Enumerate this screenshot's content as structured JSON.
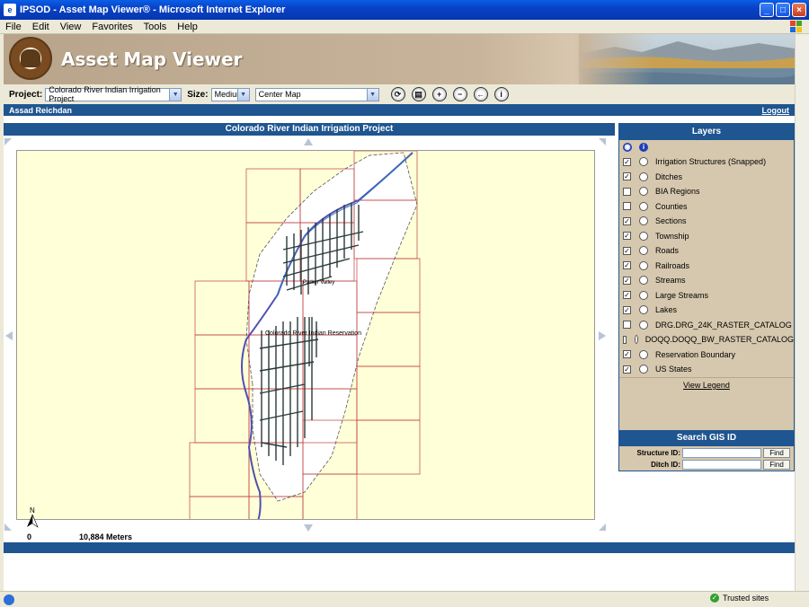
{
  "window": {
    "title": "IPSOD - Asset Map Viewer® - Microsoft Internet Explorer"
  },
  "menu": [
    "File",
    "Edit",
    "View",
    "Favorites",
    "Tools",
    "Help"
  ],
  "banner": {
    "title": "Asset Map Viewer"
  },
  "toolbar": {
    "project_label": "Project:",
    "project_value": "Colorado River Indian Irrigation Project",
    "size_label": "Size:",
    "size_value": "Medium",
    "action_value": "Center Map"
  },
  "user": {
    "name": "Assad Reichdan",
    "logout": "Logout"
  },
  "map": {
    "title": "Colorado River Indian Irrigation Project",
    "label1": "Colorado River Indian Reservation",
    "label2": "Parker Valley",
    "north": "N",
    "scale_zero": "0",
    "scale_text": "10,884 Meters"
  },
  "layers": {
    "title": "Layers",
    "items": [
      {
        "label": "Irrigation Structures (Snapped)",
        "checked": true
      },
      {
        "label": "Ditches",
        "checked": true
      },
      {
        "label": "BIA Regions",
        "checked": false
      },
      {
        "label": "Counties",
        "checked": false
      },
      {
        "label": "Sections",
        "checked": true
      },
      {
        "label": "Township",
        "checked": true
      },
      {
        "label": "Roads",
        "checked": true
      },
      {
        "label": "Railroads",
        "checked": true
      },
      {
        "label": "Streams",
        "checked": true
      },
      {
        "label": "Large Streams",
        "checked": true
      },
      {
        "label": "Lakes",
        "checked": true
      },
      {
        "label": "DRG.DRG_24K_RASTER_CATALOG",
        "checked": false
      },
      {
        "label": "DOQQ.DOQQ_BW_RASTER_CATALOG",
        "checked": false
      },
      {
        "label": "Reservation Boundary",
        "checked": true
      },
      {
        "label": "US States",
        "checked": true
      }
    ],
    "legend_link": "View Legend"
  },
  "search": {
    "title": "Search GIS ID",
    "structure_label": "Structure ID:",
    "ditch_label": "Ditch ID:",
    "find": "Find"
  },
  "status": {
    "zone": "Trusted sites"
  }
}
